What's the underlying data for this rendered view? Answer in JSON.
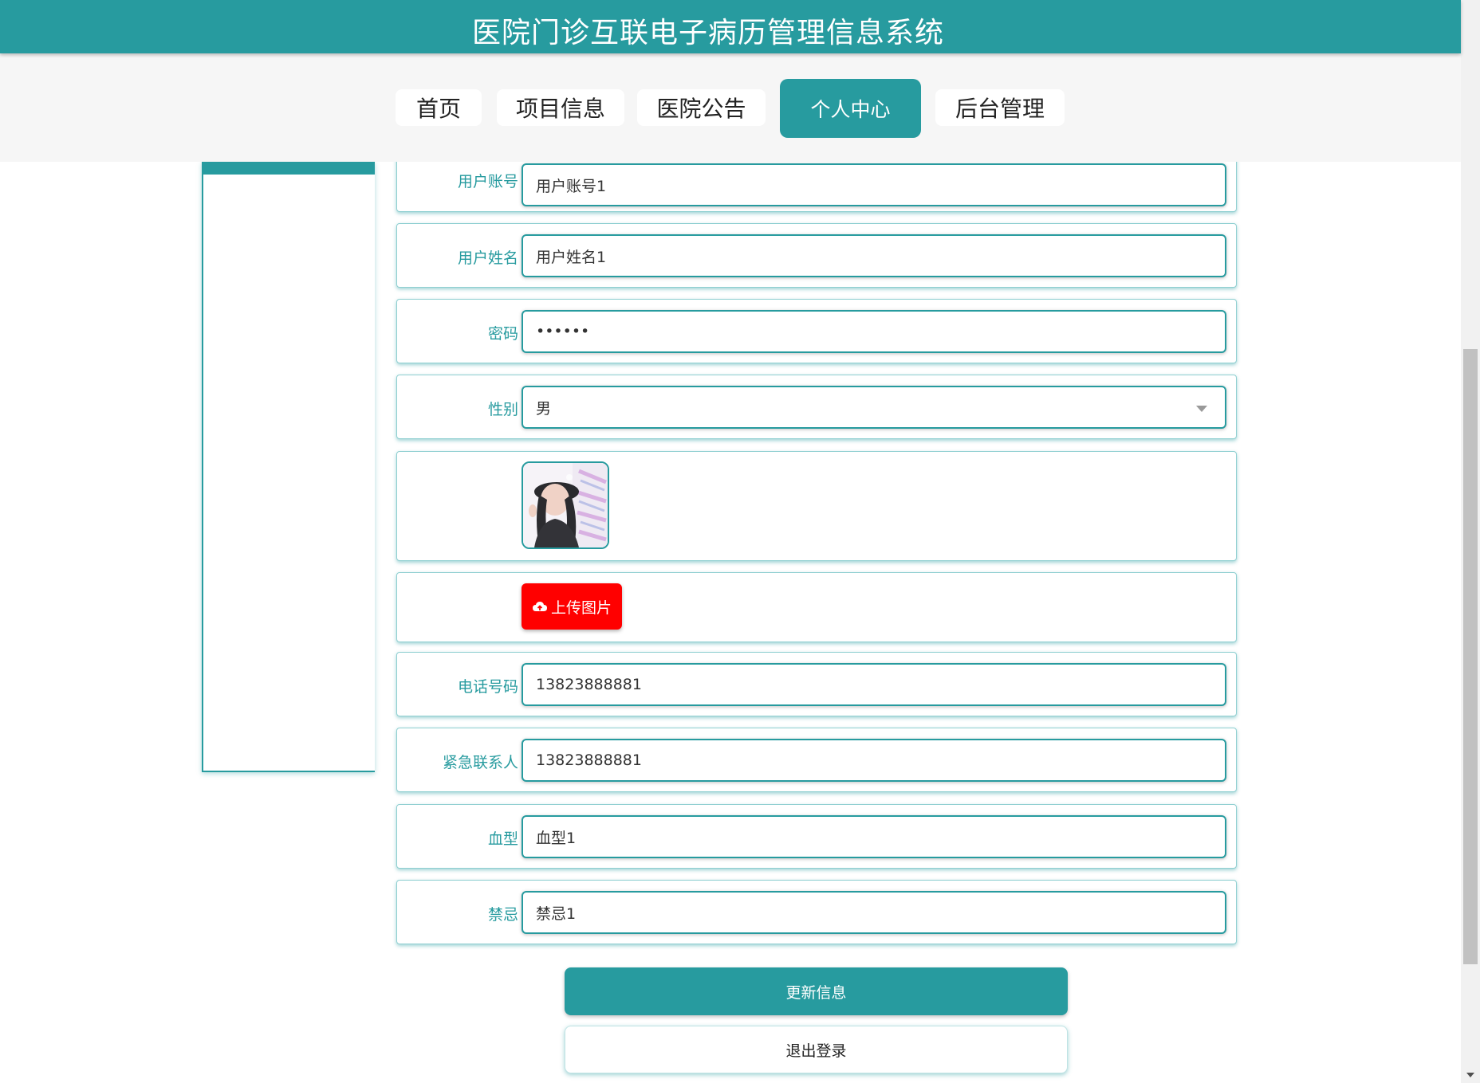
{
  "header": {
    "title": "医院门诊互联电子病历管理信息系统"
  },
  "nav": {
    "items": [
      {
        "label": "首页"
      },
      {
        "label": "项目信息"
      },
      {
        "label": "医院公告"
      },
      {
        "label": "个人中心",
        "active": true
      },
      {
        "label": "后台管理"
      }
    ]
  },
  "form": {
    "account": {
      "label": "用户账号",
      "value": "用户账号1"
    },
    "name": {
      "label": "用户姓名",
      "value": "用户姓名1"
    },
    "password": {
      "label": "密码",
      "value": "••••••"
    },
    "gender": {
      "label": "性别",
      "value": "男"
    },
    "upload_label": "上传图片",
    "phone": {
      "label": "电话号码",
      "value": "13823888881"
    },
    "emergency": {
      "label": "紧急联系人",
      "value": "13823888881"
    },
    "blood": {
      "label": "血型",
      "value": "血型1"
    },
    "taboo": {
      "label": "禁忌",
      "value": "禁忌1"
    }
  },
  "buttons": {
    "update": "更新信息",
    "logout": "退出登录"
  },
  "colors": {
    "primary": "#279b9f",
    "upload": "#ff0000"
  }
}
